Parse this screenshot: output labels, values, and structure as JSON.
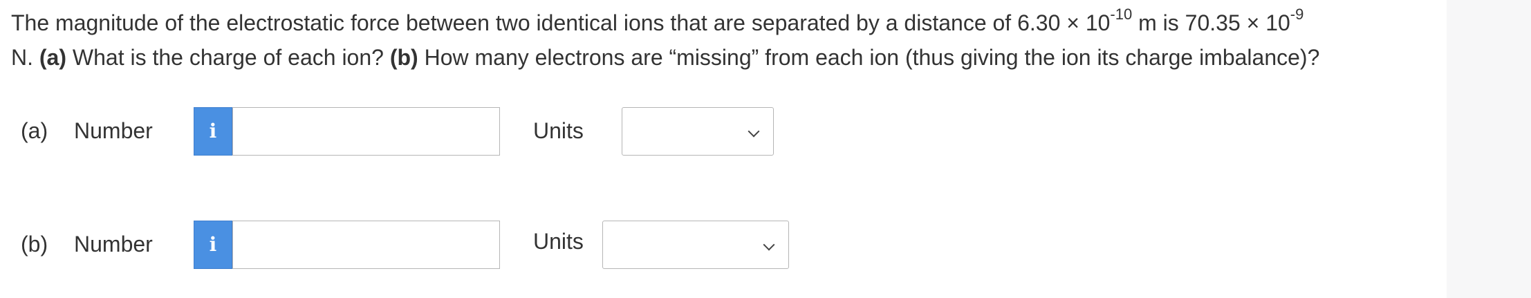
{
  "question": {
    "line1_prefix": "The magnitude of the electrostatic force between two identical ions that are separated by a distance of 6.30 × 10",
    "line1_exp1": "-10",
    "line1_mid": " m is 70.35 × 10",
    "line1_exp2": "-9",
    "line2_start": "N. ",
    "part_a_tag": "(a)",
    "part_a_text": " What is the charge of each ion? ",
    "part_b_tag": "(b)",
    "part_b_text": " How many electrons are “missing” from each ion (thus giving the ion its charge imbalance)?"
  },
  "parts": [
    {
      "label": "(a)",
      "number_label": "Number",
      "info_glyph": "i",
      "number_value": "",
      "units_label": "Units",
      "units_selected": ""
    },
    {
      "label": "(b)",
      "number_label": "Number",
      "info_glyph": "i",
      "number_value": "",
      "units_label": "Units",
      "units_selected": ""
    }
  ],
  "icons": {
    "info": "info-icon",
    "dropdown": "chevron-down-icon"
  },
  "colors": {
    "info_button": "#4a90e2",
    "text": "#333333",
    "border": "#b5b5b5"
  }
}
